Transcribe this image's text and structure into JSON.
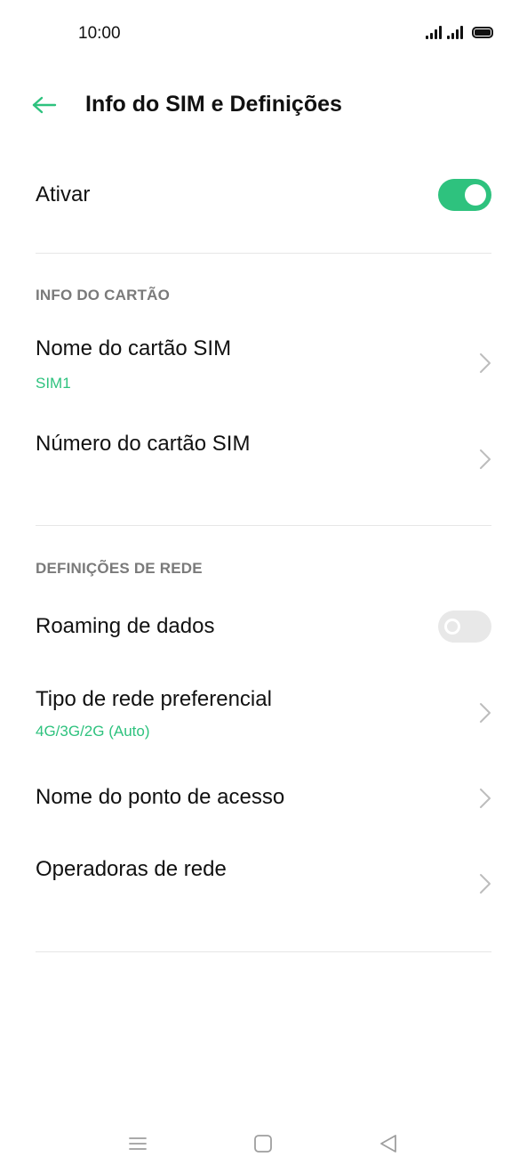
{
  "status_bar": {
    "time": "10:00",
    "icons": [
      "signal-icon",
      "signal-icon",
      "battery-icon"
    ]
  },
  "header": {
    "back_icon": "arrow-left-icon",
    "title": "Info do SIM e Definições"
  },
  "colors": {
    "accent": "#2ec27e",
    "text": "#111111",
    "section_header": "#7a7a7a",
    "divider": "#e6e6e6",
    "toggle_off": "#e8e8e8"
  },
  "activate": {
    "label": "Ativar",
    "enabled": true
  },
  "card_info": {
    "header": "INFO DO CARTÃO",
    "items": [
      {
        "label": "Nome do cartão SIM",
        "value": "SIM1"
      },
      {
        "label": "Número do cartão SIM",
        "value": ""
      }
    ]
  },
  "network": {
    "header": "DEFINIÇÕES DE REDE",
    "roaming": {
      "label": "Roaming de dados",
      "enabled": false
    },
    "items": [
      {
        "label": "Tipo de rede preferencial",
        "value": "4G/3G/2G (Auto)"
      },
      {
        "label": "Nome do ponto de acesso"
      },
      {
        "label": "Operadoras de rede"
      }
    ]
  },
  "nav_bar": {
    "icons": [
      "menu-icon",
      "home-icon",
      "back-triangle-icon"
    ]
  }
}
